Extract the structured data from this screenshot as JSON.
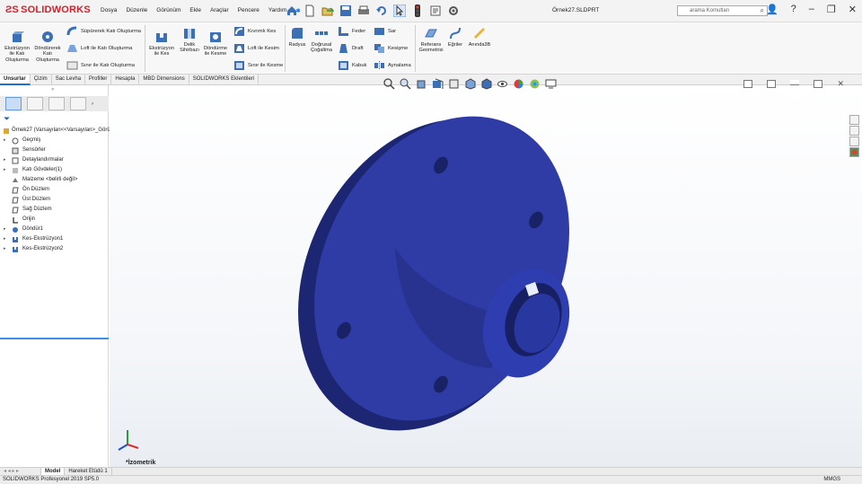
{
  "app": {
    "logo": "SOLIDWORKS",
    "document": "Örnek27.SLDPRT",
    "search_placeholder": "arama Komutları"
  },
  "menu": [
    "Dosya",
    "Düzenle",
    "Görünüm",
    "Ekle",
    "Araçlar",
    "Pencere",
    "Yardım"
  ],
  "ribbon": {
    "extrude": "Ekstrüzyon ile Katı Oluşturma",
    "revolve": "Döndürerek Katı Oluşturma",
    "sweep": "Süpürerek Katı Oluşturma",
    "loft": "Loft ile Katı Oluşturma",
    "boundary": "Sınır ile Katı Oluşturma",
    "extrude_cut": "Ekstrüzyon ile Kes",
    "hole_wizard": "Delik Sihirbazı",
    "revolve_cut": "Döndürme ile Kesme",
    "swept_cut": "Kıvrımlı Kes",
    "lofted_cut": "Loft ile Kesim",
    "boundary_cut": "Sınır ile Kesme",
    "fillet": "Radyus",
    "pattern": "Doğrusal Çoğaltma",
    "rib": "Feder",
    "draft": "Draft",
    "shell": "Kabuk",
    "wrap": "Sar",
    "intersect": "Kesişme",
    "mirror": "Aynalama",
    "ref_geom": "Referans Geometrisi",
    "curves": "Eğriler",
    "instant3d": "Anında3B"
  },
  "tabs": [
    "Unsurlar",
    "Çizim",
    "Sac Levha",
    "Profiller",
    "Hesapla",
    "MBD Dimensions",
    "SOLIDWORKS Eklentileri"
  ],
  "active_tab": "Unsurlar",
  "tree": {
    "root": "Örnek27  (Varsayılan<<Varsayılan>_Görü",
    "items": [
      "Geçmiş",
      "Sensörler",
      "Detaylandırmalar",
      "Katı Gövdeler(1)",
      "Malzeme <belirli değil>",
      "Ön Düzlem",
      "Üst Düzlem",
      "Sağ Düzlem",
      "Orijin",
      "Döndür1",
      "Kes-Ekstrüzyon1",
      "Kes-Ekstrüzyon2"
    ]
  },
  "view_label": "*İzometrik",
  "bottom_tabs": [
    "Model",
    "Hareket Etüdü 1"
  ],
  "status": {
    "left": "SOLIDWORKS Profesyonel 2019 SP5.0",
    "right": "MMGS"
  },
  "colors": {
    "part": "#2e3a9e",
    "accent": "#1f6fd0",
    "logo": "#d4202a"
  }
}
